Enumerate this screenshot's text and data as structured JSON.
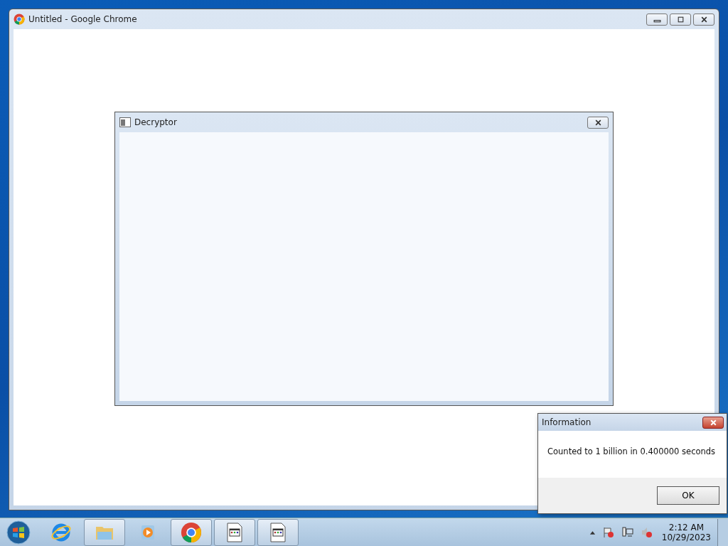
{
  "browser_window": {
    "title": "Untitled - Google Chrome"
  },
  "app_window": {
    "title": "Decryptor"
  },
  "dialog": {
    "title": "Information",
    "message": "Counted to 1 billion in 0.400000 seconds",
    "button": "OK"
  },
  "taskbar": {
    "apps": [
      {
        "kind": "ie",
        "running": false
      },
      {
        "kind": "explorer",
        "running": true
      },
      {
        "kind": "media",
        "running": false
      },
      {
        "kind": "chrome",
        "running": true
      },
      {
        "kind": "program",
        "running": true
      },
      {
        "kind": "program",
        "running": true
      }
    ],
    "clock": {
      "time": "2:12 AM",
      "date": "10/29/2023"
    }
  }
}
